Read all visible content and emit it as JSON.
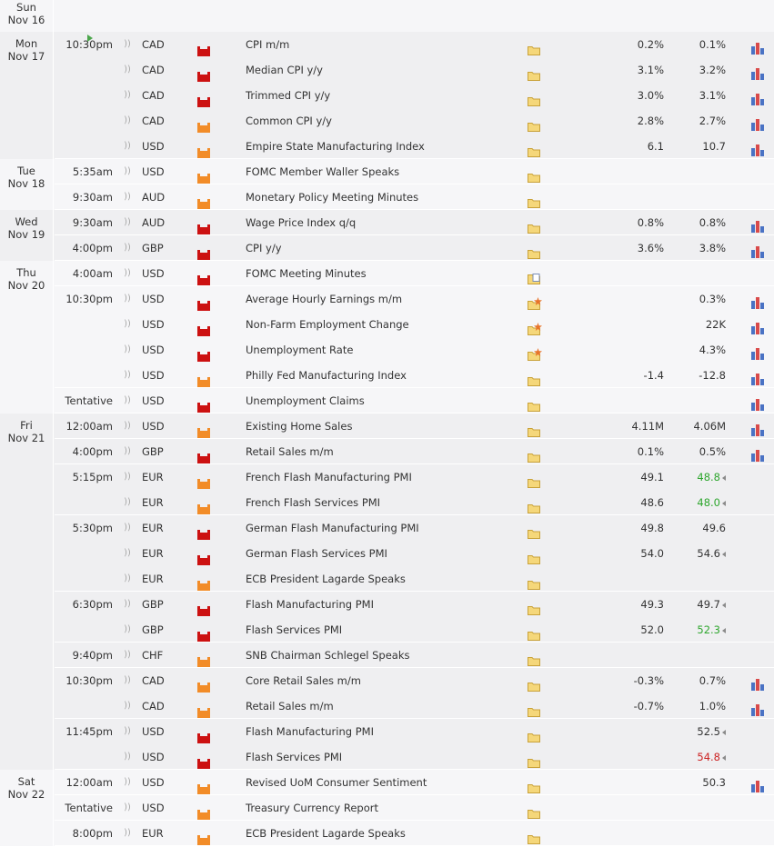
{
  "colors": {
    "shaded": "#efeff1",
    "plain": "#f6f6f8",
    "impact_high": "#cc1111",
    "impact_medium": "#f28c28",
    "actual_better": "#2ea62e",
    "actual_worse": "#cc2222"
  },
  "days": [
    {
      "dn": "Sun",
      "dd": "Nov 16",
      "shade": "plain",
      "groups": []
    },
    {
      "dn": "Mon",
      "dd": "Nov 17",
      "shade": "shaded",
      "groups": [
        {
          "time": "10:30pm",
          "playing": true,
          "rows": [
            {
              "currency": "CAD",
              "impact": "high",
              "event": "CPI m/m",
              "folder": "folder-icon",
              "forecast": "0.2%",
              "previous": "0.1%",
              "graph": true
            },
            {
              "currency": "CAD",
              "impact": "high",
              "event": "Median CPI y/y",
              "folder": "folder-icon",
              "forecast": "3.1%",
              "previous": "3.2%",
              "graph": true
            },
            {
              "currency": "CAD",
              "impact": "high",
              "event": "Trimmed CPI y/y",
              "folder": "folder-icon",
              "forecast": "3.0%",
              "previous": "3.1%",
              "graph": true
            },
            {
              "currency": "CAD",
              "impact": "medium",
              "event": "Common CPI y/y",
              "folder": "folder-icon",
              "forecast": "2.8%",
              "previous": "2.7%",
              "graph": true
            },
            {
              "currency": "USD",
              "impact": "medium",
              "event": "Empire State Manufacturing Index",
              "folder": "folder-icon",
              "forecast": "6.1",
              "previous": "10.7",
              "graph": true
            }
          ]
        }
      ]
    },
    {
      "dn": "Tue",
      "dd": "Nov 18",
      "shade": "plain",
      "groups": [
        {
          "time": "5:35am",
          "rows": [
            {
              "currency": "USD",
              "impact": "medium",
              "event": "FOMC Member Waller Speaks",
              "folder": "folder-icon",
              "forecast": "",
              "previous": "",
              "graph": false
            }
          ]
        },
        {
          "time": "9:30am",
          "rows": [
            {
              "currency": "AUD",
              "impact": "medium",
              "event": "Monetary Policy Meeting Minutes",
              "folder": "folder-icon",
              "forecast": "",
              "previous": "",
              "graph": false
            }
          ]
        }
      ]
    },
    {
      "dn": "Wed",
      "dd": "Nov 19",
      "shade": "shaded",
      "groups": [
        {
          "time": "9:30am",
          "rows": [
            {
              "currency": "AUD",
              "impact": "high",
              "event": "Wage Price Index q/q",
              "folder": "folder-icon",
              "forecast": "0.8%",
              "previous": "0.8%",
              "graph": true
            }
          ]
        },
        {
          "time": "4:00pm",
          "rows": [
            {
              "currency": "GBP",
              "impact": "high",
              "event": "CPI y/y",
              "folder": "folder-icon",
              "forecast": "3.6%",
              "previous": "3.8%",
              "graph": true
            }
          ]
        }
      ]
    },
    {
      "dn": "Thu",
      "dd": "Nov 20",
      "shade": "plain",
      "groups": [
        {
          "time": "4:00am",
          "rows": [
            {
              "currency": "USD",
              "impact": "high",
              "event": "FOMC Meeting Minutes",
              "folder": "folder-doc-icon",
              "forecast": "",
              "previous": "",
              "graph": false
            }
          ]
        },
        {
          "time": "10:30pm",
          "rows": [
            {
              "currency": "USD",
              "impact": "high",
              "event": "Average Hourly Earnings m/m",
              "folder": "folder-star-icon",
              "forecast": "",
              "previous": "0.3%",
              "graph": true
            },
            {
              "currency": "USD",
              "impact": "high",
              "event": "Non-Farm Employment Change",
              "folder": "folder-star-icon",
              "forecast": "",
              "previous": "22K",
              "graph": true
            },
            {
              "currency": "USD",
              "impact": "high",
              "event": "Unemployment Rate",
              "folder": "folder-star-icon",
              "forecast": "",
              "previous": "4.3%",
              "graph": true
            },
            {
              "currency": "USD",
              "impact": "medium",
              "event": "Philly Fed Manufacturing Index",
              "folder": "folder-icon",
              "forecast": "-1.4",
              "previous": "-12.8",
              "graph": true
            }
          ]
        },
        {
          "time": "Tentative",
          "rows": [
            {
              "currency": "USD",
              "impact": "high",
              "event": "Unemployment Claims",
              "folder": "folder-icon",
              "forecast": "",
              "previous": "",
              "graph": true
            }
          ]
        }
      ]
    },
    {
      "dn": "Fri",
      "dd": "Nov 21",
      "shade": "shaded",
      "groups": [
        {
          "time": "12:00am",
          "rows": [
            {
              "currency": "USD",
              "impact": "medium",
              "event": "Existing Home Sales",
              "folder": "folder-icon",
              "forecast": "4.11M",
              "previous": "4.06M",
              "graph": true
            }
          ]
        },
        {
          "time": "4:00pm",
          "rows": [
            {
              "currency": "GBP",
              "impact": "high",
              "event": "Retail Sales m/m",
              "folder": "folder-icon",
              "forecast": "0.1%",
              "previous": "0.5%",
              "graph": true
            }
          ]
        },
        {
          "time": "5:15pm",
          "rows": [
            {
              "currency": "EUR",
              "impact": "medium",
              "event": "French Flash Manufacturing PMI",
              "folder": "folder-icon",
              "forecast": "49.1",
              "previous": "48.8",
              "prev_color": "up",
              "arrow": true,
              "graph": false
            },
            {
              "currency": "EUR",
              "impact": "medium",
              "event": "French Flash Services PMI",
              "folder": "folder-icon",
              "forecast": "48.6",
              "previous": "48.0",
              "prev_color": "up",
              "arrow": true,
              "graph": false
            }
          ]
        },
        {
          "time": "5:30pm",
          "rows": [
            {
              "currency": "EUR",
              "impact": "high",
              "event": "German Flash Manufacturing PMI",
              "folder": "folder-icon",
              "forecast": "49.8",
              "previous": "49.6",
              "graph": false
            },
            {
              "currency": "EUR",
              "impact": "high",
              "event": "German Flash Services PMI",
              "folder": "folder-icon",
              "forecast": "54.0",
              "previous": "54.6",
              "arrow": true,
              "graph": false
            },
            {
              "currency": "EUR",
              "impact": "medium",
              "event": "ECB President Lagarde Speaks",
              "folder": "folder-icon",
              "forecast": "",
              "previous": "",
              "graph": false
            }
          ]
        },
        {
          "time": "6:30pm",
          "rows": [
            {
              "currency": "GBP",
              "impact": "high",
              "event": "Flash Manufacturing PMI",
              "folder": "folder-icon",
              "forecast": "49.3",
              "previous": "49.7",
              "arrow": true,
              "graph": false
            },
            {
              "currency": "GBP",
              "impact": "high",
              "event": "Flash Services PMI",
              "folder": "folder-icon",
              "forecast": "52.0",
              "previous": "52.3",
              "prev_color": "up",
              "arrow": true,
              "graph": false
            }
          ]
        },
        {
          "time": "9:40pm",
          "rows": [
            {
              "currency": "CHF",
              "impact": "medium",
              "event": "SNB Chairman Schlegel Speaks",
              "folder": "folder-icon",
              "forecast": "",
              "previous": "",
              "graph": false
            }
          ]
        },
        {
          "time": "10:30pm",
          "rows": [
            {
              "currency": "CAD",
              "impact": "medium",
              "event": "Core Retail Sales m/m",
              "folder": "folder-icon",
              "forecast": "-0.3%",
              "previous": "0.7%",
              "graph": true
            },
            {
              "currency": "CAD",
              "impact": "medium",
              "event": "Retail Sales m/m",
              "folder": "folder-icon",
              "forecast": "-0.7%",
              "previous": "1.0%",
              "graph": true
            }
          ]
        },
        {
          "time": "11:45pm",
          "rows": [
            {
              "currency": "USD",
              "impact": "high",
              "event": "Flash Manufacturing PMI",
              "folder": "folder-icon",
              "forecast": "",
              "previous": "52.5",
              "arrow": true,
              "graph": false
            },
            {
              "currency": "USD",
              "impact": "high",
              "event": "Flash Services PMI",
              "folder": "folder-icon",
              "forecast": "",
              "previous": "54.8",
              "prev_color": "down",
              "arrow": true,
              "graph": false
            }
          ]
        }
      ]
    },
    {
      "dn": "Sat",
      "dd": "Nov 22",
      "shade": "plain",
      "groups": [
        {
          "time": "12:00am",
          "rows": [
            {
              "currency": "USD",
              "impact": "medium",
              "event": "Revised UoM Consumer Sentiment",
              "folder": "folder-icon",
              "forecast": "",
              "previous": "50.3",
              "graph": true
            }
          ]
        },
        {
          "time": "Tentative",
          "rows": [
            {
              "currency": "USD",
              "impact": "medium",
              "event": "Treasury Currency Report",
              "folder": "folder-icon",
              "forecast": "",
              "previous": "",
              "graph": false
            }
          ]
        },
        {
          "time": "8:00pm",
          "rows": [
            {
              "currency": "EUR",
              "impact": "medium",
              "event": "ECB President Lagarde Speaks",
              "folder": "folder-icon",
              "forecast": "",
              "previous": "",
              "graph": false
            }
          ]
        }
      ]
    }
  ]
}
